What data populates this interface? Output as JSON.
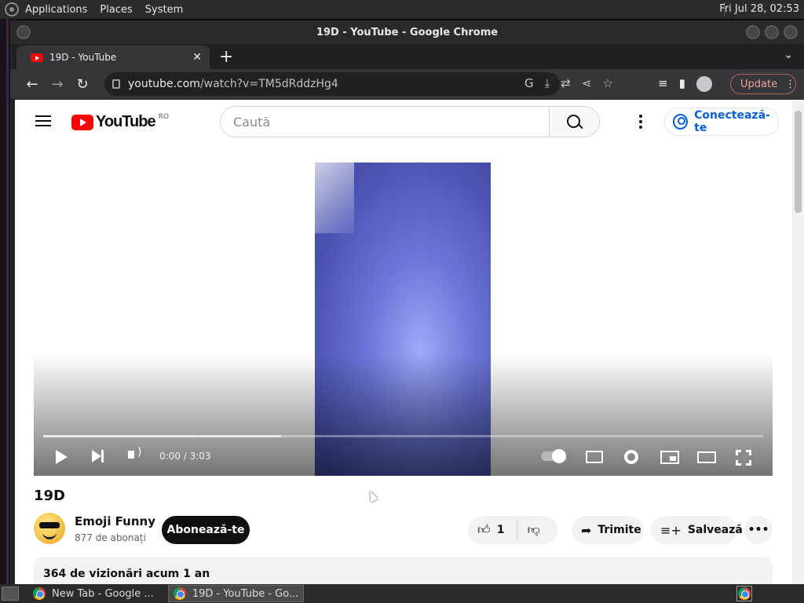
{
  "desktop": {
    "menus": [
      "Applications",
      "Places",
      "System"
    ],
    "clock": "Fri Jul 28, 02:53"
  },
  "window": {
    "title": "19D - YouTube - Google Chrome"
  },
  "browser": {
    "tab_title": "19D - YouTube",
    "url_host": "youtube.com",
    "url_path": "/watch?v=TM5dRddzHg4",
    "update_label": "Update"
  },
  "youtube": {
    "logo_text": "YouTube",
    "region": "RO",
    "search_placeholder": "Caută",
    "signin_label": "Conectează-te"
  },
  "player": {
    "time": "0:00 / 3:03",
    "progress_loaded_fraction": 0.33
  },
  "video": {
    "title": "19D",
    "channel_name": "Emoji Funny",
    "channel_subs": "877 de abonați",
    "subscribe_label": "Abonează-te",
    "like_count": "1",
    "share_label": "Trimite",
    "save_label": "Salvează",
    "description_meta": "364 de vizionări  acum 1 an"
  },
  "taskbar": {
    "tasks": [
      "New Tab - Google ...",
      "19D - YouTube - Go..."
    ]
  }
}
